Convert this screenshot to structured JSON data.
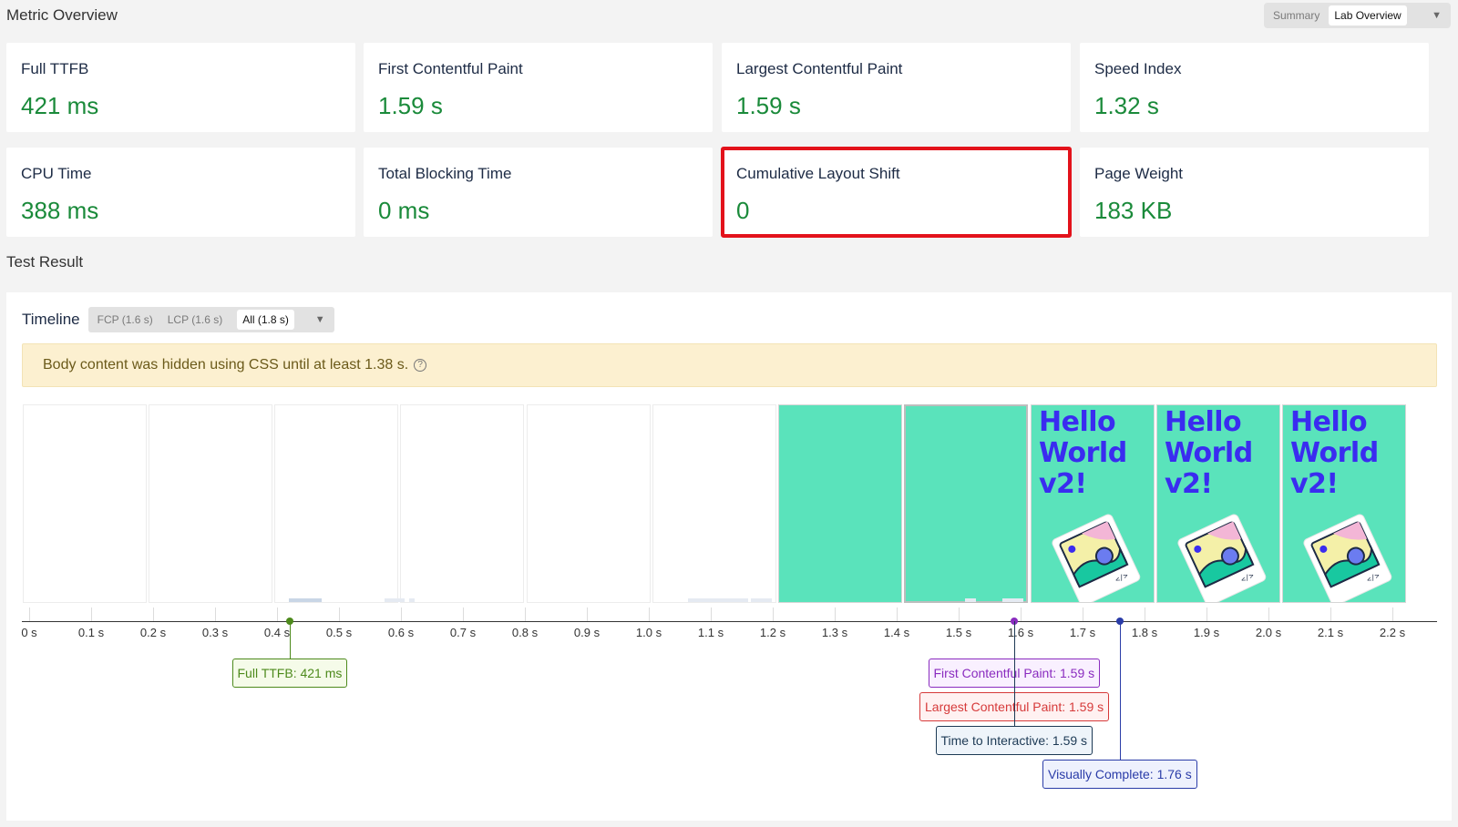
{
  "metric_overview": {
    "title": "Metric Overview",
    "view_options": [
      "Summary",
      "Lab Overview"
    ],
    "selected_view": "Lab Overview",
    "cards": [
      {
        "label": "Full TTFB",
        "value": "421 ms"
      },
      {
        "label": "First Contentful Paint",
        "value": "1.59 s"
      },
      {
        "label": "Largest Contentful Paint",
        "value": "1.59 s"
      },
      {
        "label": "Speed Index",
        "value": "1.32 s"
      },
      {
        "label": "CPU Time",
        "value": "388 ms"
      },
      {
        "label": "Total Blocking Time",
        "value": "0 ms"
      },
      {
        "label": "Cumulative Layout Shift",
        "value": "0",
        "highlighted": true
      },
      {
        "label": "Page Weight",
        "value": "183 KB"
      }
    ],
    "value_color": "#1a8a3a",
    "highlight_color": "#e3121b"
  },
  "test_result": {
    "title": "Test Result",
    "timeline": {
      "title": "Timeline",
      "filters": [
        "FCP (1.6 s)",
        "LCP (1.6 s)",
        "All (1.8 s)"
      ],
      "selected_filter": "All (1.8 s)"
    },
    "warning": {
      "text": "Body content was hidden using CSS until at least 1.38 s.",
      "icon": "help-circle-icon"
    },
    "filmstrip": {
      "frame_text": "Hello World v2!",
      "frames": [
        "blank",
        "blank",
        "blank",
        "blank",
        "blank",
        "blank",
        "green",
        "green",
        "content",
        "content",
        "content"
      ],
      "accent_color": "#5ae3bb",
      "text_color": "#3a2cf0"
    },
    "axis": {
      "ticks": [
        "0 s",
        "0.1 s",
        "0.2 s",
        "0.3 s",
        "0.4 s",
        "0.5 s",
        "0.6 s",
        "0.7 s",
        "0.8 s",
        "0.9 s",
        "1.0 s",
        "1.1 s",
        "1.2 s",
        "1.3 s",
        "1.4 s",
        "1.5 s",
        "1.6 s",
        "1.7 s",
        "1.8 s",
        "1.9 s",
        "2.0 s",
        "2.1 s",
        "2.2 s"
      ]
    },
    "events": [
      {
        "label": "Full TTFB: 421 ms",
        "time": 0.421,
        "color": "#4d8a1c",
        "bg": "#f5fbe9",
        "row": 0
      },
      {
        "label": "First Contentful Paint: 1.59 s",
        "time": 1.59,
        "color": "#8a2cbf",
        "bg": "#f9f0ff",
        "row": 0
      },
      {
        "label": "Largest Contentful Paint: 1.59 s",
        "time": 1.59,
        "color": "#d63a3a",
        "bg": "#fff1f1",
        "row": 1
      },
      {
        "label": "Time to Interactive: 1.59 s",
        "time": 1.59,
        "color": "#1d3a55",
        "bg": "#eef4fa",
        "row": 2
      },
      {
        "label": "Visually Complete: 1.76 s",
        "time": 1.76,
        "color": "#2a3ca8",
        "bg": "#eef1fd",
        "row": 3
      }
    ]
  }
}
